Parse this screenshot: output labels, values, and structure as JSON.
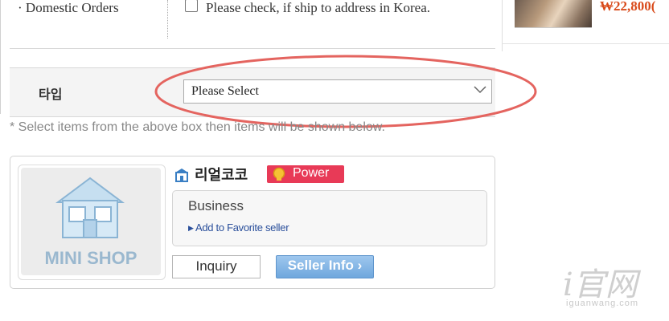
{
  "shipping": {
    "label": "· Domestic Orders",
    "checkbox_text": "Please check, if ship to address in Korea."
  },
  "product": {
    "price": "₩22,800("
  },
  "type_row": {
    "label": "타입",
    "select_value": "Please Select"
  },
  "hint": "* Select items from the above box then items will be shown below.",
  "seller": {
    "mini_shop": "MINI SHOP",
    "name": "리얼코코",
    "badge": "Power",
    "business": "Business",
    "favorite_link": "Add to Favorite seller",
    "inquiry": "Inquiry",
    "seller_info": "Seller Info"
  },
  "watermark": {
    "main": "i官网",
    "sub": "iguanwang.com"
  },
  "colors": {
    "annotation_ellipse": "#e4645f",
    "power_badge": "#e83a57",
    "seller_info_button": "#6fa7dd",
    "price": "#d94a1a",
    "link": "#2a4f9b"
  }
}
